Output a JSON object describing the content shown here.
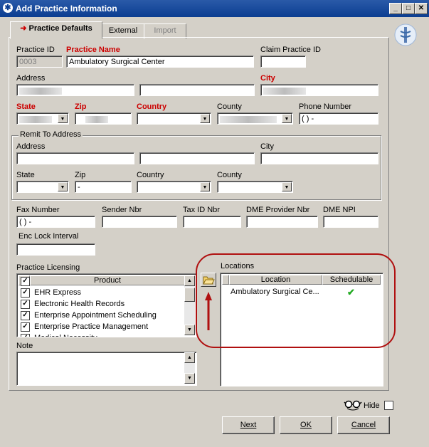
{
  "window": {
    "title": "Add Practice Information"
  },
  "tabs": {
    "practice_defaults": "Practice Defaults",
    "external": "External",
    "import": "Import"
  },
  "fields": {
    "practice_id_label": "Practice ID",
    "practice_id_value": "0003",
    "practice_name_label": "Practice Name",
    "practice_name_value": "Ambulatory Surgical Center",
    "claim_practice_id_label": "Claim Practice ID",
    "address_label": "Address",
    "city_label": "City",
    "state_label": "State",
    "zip_label": "Zip",
    "country_label": "Country",
    "county_label": "County",
    "phone_label": "Phone Number",
    "phone_value": "(  )   -"
  },
  "remit": {
    "group_label": "Remit To Address",
    "address_label": "Address",
    "city_label": "City",
    "state_label": "State",
    "zip_label": "Zip",
    "zip_value": "   -",
    "country_label": "Country",
    "county_label": "County"
  },
  "other": {
    "fax_label": "Fax Number",
    "fax_value": "(  )   -",
    "sender_label": "Sender Nbr",
    "taxid_label": "Tax ID Nbr",
    "dme_provider_label": "DME Provider Nbr",
    "dme_npi_label": "DME NPI",
    "enc_lock_label": "Enc Lock Interval"
  },
  "licensing": {
    "label": "Practice Licensing",
    "column": "Product",
    "products": [
      "EHR Express",
      "Electronic Health Records",
      "Enterprise Appointment Scheduling",
      "Enterprise Practice Management",
      "Medical Necessity"
    ]
  },
  "locations": {
    "label": "Locations",
    "col_location": "Location",
    "col_schedulable": "Schedulable",
    "rows": [
      {
        "location": "Ambulatory Surgical Ce...",
        "schedulable": "✔"
      }
    ]
  },
  "note": {
    "label": "Note"
  },
  "footer": {
    "hide_label": "Hide",
    "next": "Next",
    "ok": "OK",
    "cancel": "Cancel"
  },
  "colors": {
    "required": "#cc0000",
    "annotation": "#b01010",
    "check": "#22aa22"
  }
}
